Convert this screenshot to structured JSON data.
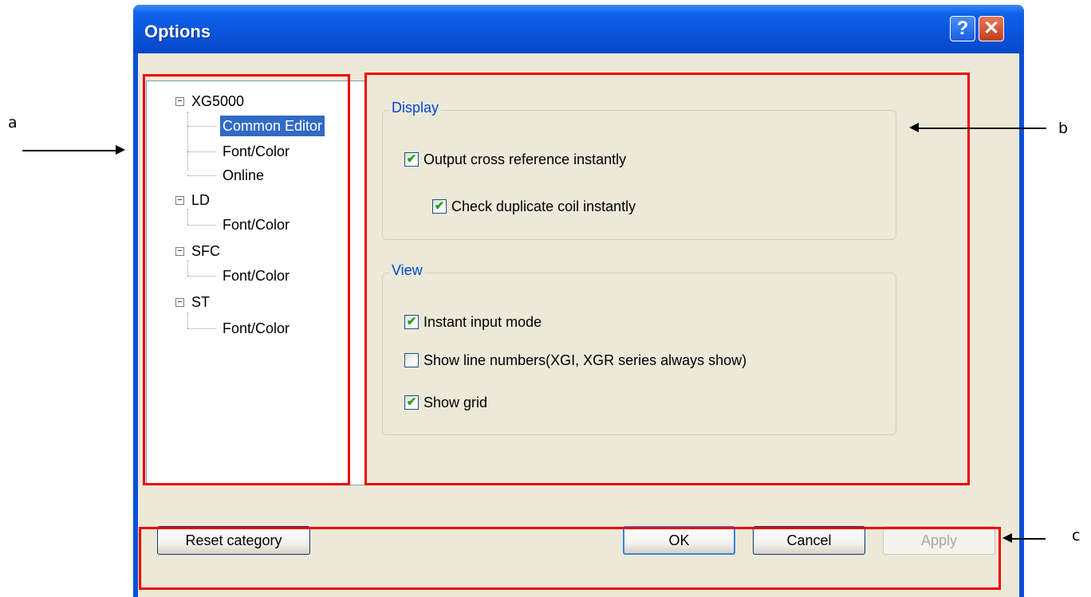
{
  "window": {
    "title": "Options",
    "help_glyph": "?",
    "close_glyph": "✕"
  },
  "tree": {
    "items": [
      {
        "label": "XG5000",
        "level": 0,
        "expanded": true
      },
      {
        "label": "Common Editor",
        "level": 1,
        "selected": true
      },
      {
        "label": "Font/Color",
        "level": 1
      },
      {
        "label": "Online",
        "level": 1
      },
      {
        "label": "LD",
        "level": 0,
        "expanded": true
      },
      {
        "label": "Font/Color",
        "level": 1
      },
      {
        "label": "SFC",
        "level": 0,
        "expanded": true
      },
      {
        "label": "Font/Color",
        "level": 1
      },
      {
        "label": "ST",
        "level": 0,
        "expanded": true
      },
      {
        "label": "Font/Color",
        "level": 1
      }
    ],
    "expander_glyph": "−"
  },
  "display_group": {
    "title": "Display",
    "options": [
      {
        "label": "Output cross reference instantly",
        "checked": true
      },
      {
        "label": "Check duplicate coil instantly",
        "checked": true
      }
    ]
  },
  "view_group": {
    "title": "View",
    "options": [
      {
        "label": "Instant input mode",
        "checked": true
      },
      {
        "label": "Show line numbers(XGI, XGR series always show)",
        "checked": false
      },
      {
        "label": "Show grid",
        "checked": true
      }
    ]
  },
  "buttons": {
    "reset": "Reset category",
    "ok": "OK",
    "cancel": "Cancel",
    "apply": "Apply"
  },
  "annotations": {
    "a": "a",
    "b": "b",
    "c": "c"
  },
  "colors": {
    "highlight": "#ee0000",
    "selection": "#316ac5",
    "group_title": "#0046d5",
    "check_mark": "#21a121"
  },
  "check_glyph": "✔"
}
